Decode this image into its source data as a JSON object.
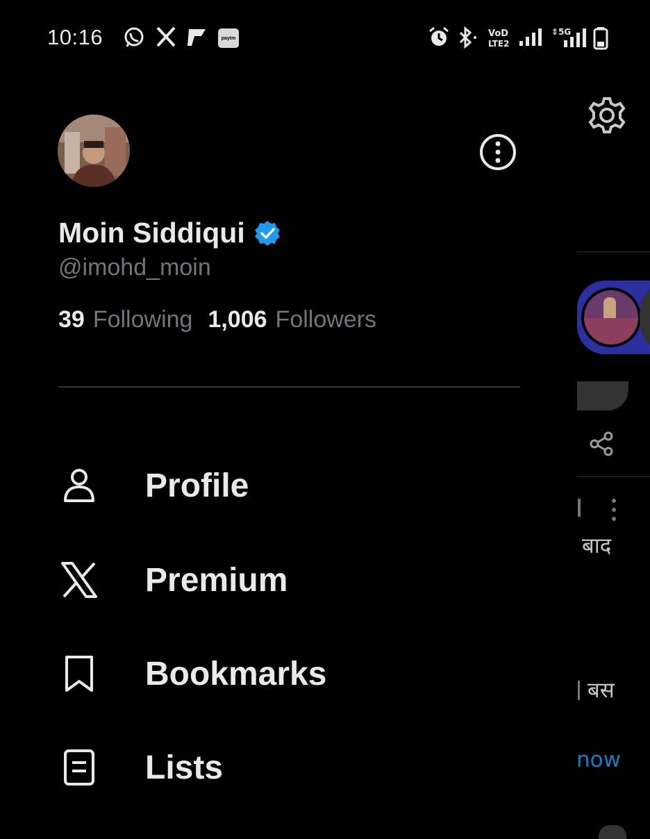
{
  "status_bar": {
    "time": "10:16",
    "paytm_label": "paytm",
    "network_label": "5G",
    "volte_label": "VoD LTE2"
  },
  "profile": {
    "display_name": "Moin Siddiqui",
    "handle": "@imohd_moin",
    "following_count": "39",
    "following_label": "Following",
    "followers_count": "1,006",
    "followers_label": "Followers"
  },
  "menu": {
    "items": [
      {
        "label": "Profile",
        "icon": "person-icon"
      },
      {
        "label": "Premium",
        "icon": "x-logo-icon"
      },
      {
        "label": "Bookmarks",
        "icon": "bookmark-icon"
      },
      {
        "label": "Lists",
        "icon": "list-icon"
      }
    ]
  },
  "background": {
    "text_1": "बाद",
    "text_2": "बस",
    "text_3": "now"
  },
  "colors": {
    "background": "#000000",
    "primary_text": "#e7e9ea",
    "secondary_text": "#71767b",
    "verified_blue": "#1d9bf0",
    "divider": "#2f3336"
  }
}
